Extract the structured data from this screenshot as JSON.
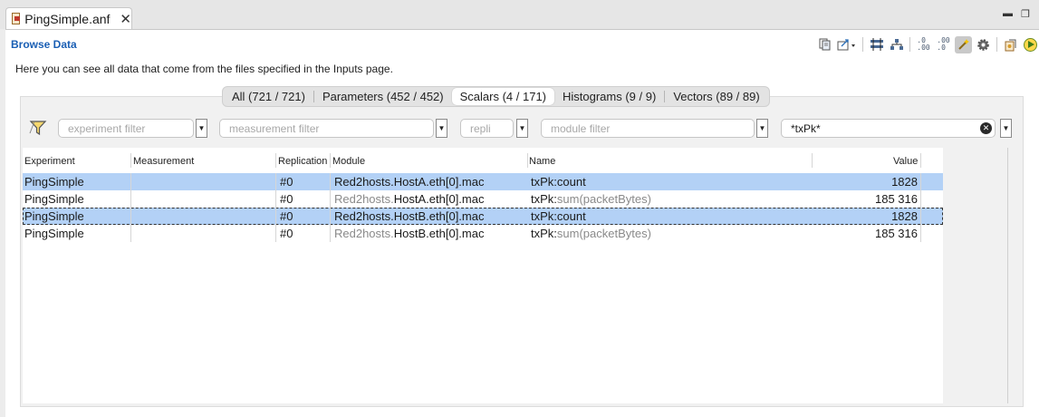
{
  "editor_tab": {
    "title": "PingSimple.anf",
    "close": "✕"
  },
  "window_controls": {
    "minimize": "▬",
    "maximize": "❐"
  },
  "page": {
    "title": "Browse Data",
    "intro": "Here you can see all data that come from the files specified in the Inputs page."
  },
  "toolbar": {
    "icons": [
      "copy-icon",
      "export-icon",
      "flatten-icon",
      "tree-icon",
      "increase-precision-icon",
      "decrease-precision-icon",
      "wand-icon",
      "gear-icon",
      "open-icon",
      "run-icon"
    ],
    "precision_up": ".0\n.00",
    "precision_down": ".00\n.0"
  },
  "tabs": [
    {
      "label": "All (721 / 721)"
    },
    {
      "label": "Parameters (452 / 452)"
    },
    {
      "label": "Scalars (4 / 171)",
      "selected": true
    },
    {
      "label": "Histograms (9 / 9)"
    },
    {
      "label": "Vectors (89 / 89)"
    }
  ],
  "filters": {
    "experiment": {
      "placeholder": "experiment filter",
      "value": ""
    },
    "measurement": {
      "placeholder": "measurement filter",
      "value": ""
    },
    "replication": {
      "placeholder": "repli",
      "value": ""
    },
    "module": {
      "placeholder": "module filter",
      "value": ""
    },
    "name": {
      "placeholder": "",
      "value": "*txPk*"
    },
    "dropdown_arrow": "▼",
    "clear": "✕"
  },
  "table": {
    "columns": [
      "Experiment",
      "Measurement",
      "Replication",
      "Module",
      "Name",
      "Value"
    ],
    "rows": [
      {
        "experiment": "PingSimple",
        "measurement": "",
        "replication": "#0",
        "module_prefix": "Red2hosts.",
        "module_rest": "HostA.eth[0].mac",
        "module_prefix_dim": false,
        "name_main": "txPk:",
        "name_rest": "count",
        "name_rest_dim": false,
        "value": "1828",
        "selected": true,
        "focused": false
      },
      {
        "experiment": "PingSimple",
        "measurement": "",
        "replication": "#0",
        "module_prefix": "Red2hosts.",
        "module_rest": "HostA.eth[0].mac",
        "module_prefix_dim": true,
        "name_main": "txPk:",
        "name_rest": "sum(packetBytes)",
        "name_rest_dim": true,
        "value": "185 316",
        "selected": false,
        "focused": false
      },
      {
        "experiment": "PingSimple",
        "measurement": "",
        "replication": "#0",
        "module_prefix": "Red2hosts.",
        "module_rest": "HostB.eth[0].mac",
        "module_prefix_dim": false,
        "name_main": "txPk:",
        "name_rest": "count",
        "name_rest_dim": false,
        "value": "1828",
        "selected": true,
        "focused": true
      },
      {
        "experiment": "PingSimple",
        "measurement": "",
        "replication": "#0",
        "module_prefix": "Red2hosts.",
        "module_rest": "HostB.eth[0].mac",
        "module_prefix_dim": true,
        "name_main": "txPk:",
        "name_rest": "sum(packetBytes)",
        "name_rest_dim": true,
        "value": "185 316",
        "selected": false,
        "focused": false
      }
    ]
  }
}
